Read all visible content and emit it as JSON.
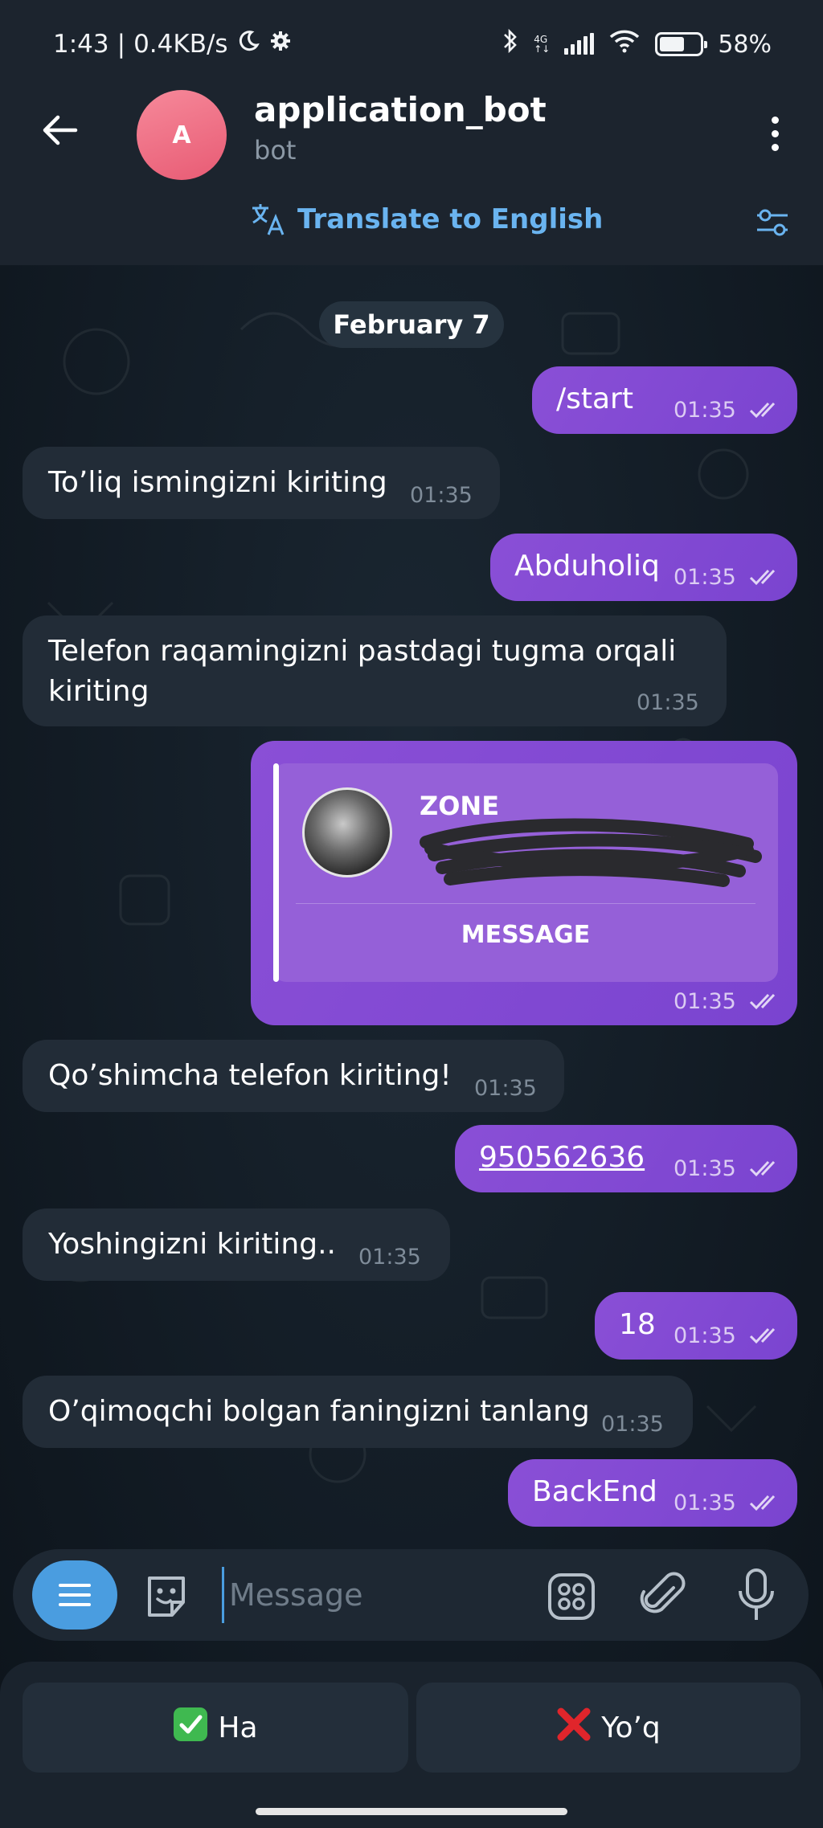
{
  "status_bar": {
    "time": "1:43",
    "speed": "0.4KB/s",
    "network": "4G",
    "battery": "58%"
  },
  "header": {
    "avatar_letter": "A",
    "title": "application_bot",
    "subtitle": "bot",
    "translate_label": "Translate to English"
  },
  "date_pill": "February 7",
  "messages": [
    {
      "dir": "out",
      "text": "/start",
      "time": "01:35"
    },
    {
      "dir": "in",
      "text": "To’liq ismingizni kiriting",
      "time": "01:35"
    },
    {
      "dir": "out",
      "text": "Abduholiq",
      "time": "01:35"
    },
    {
      "dir": "in",
      "text_line1": "Telefon raqamingizni pastdagi tugma orqali",
      "text_line2": "kiriting",
      "time": "01:35"
    },
    {
      "dir": "out",
      "type": "contact",
      "name": "ZONE",
      "action": "MESSAGE",
      "time": "01:35"
    },
    {
      "dir": "in",
      "text": "Qo’shimcha telefon kiriting!",
      "time": "01:35"
    },
    {
      "dir": "out",
      "text": "950562636",
      "time": "01:35"
    },
    {
      "dir": "in",
      "text": "Yoshingizni kiriting..",
      "time": "01:35"
    },
    {
      "dir": "out",
      "text": "18",
      "time": "01:35"
    },
    {
      "dir": "in",
      "text": "O’qimoqchi bolgan faningizni tanlang",
      "time": "01:35"
    },
    {
      "dir": "out",
      "text": "BackEnd",
      "time": "01:35"
    }
  ],
  "input": {
    "placeholder": "Message"
  },
  "keyboard": {
    "yes_label": "Ha",
    "no_label": "Yo’q"
  },
  "icons": {
    "back": "arrow-left-icon",
    "menu": "more-vertical-icon",
    "translate": "translate-icon",
    "sliders": "sliders-icon",
    "sticker": "sticker-icon",
    "apps": "apps-icon",
    "attach": "paperclip-icon",
    "mic": "microphone-icon",
    "yes": "check-mark-icon",
    "no": "cross-mark-icon"
  },
  "colors": {
    "outgoing_bubble": "#8a4fd6",
    "incoming_bubble": "#222c37",
    "accent": "#6ab4f0",
    "avatar": "#ee6f85"
  }
}
